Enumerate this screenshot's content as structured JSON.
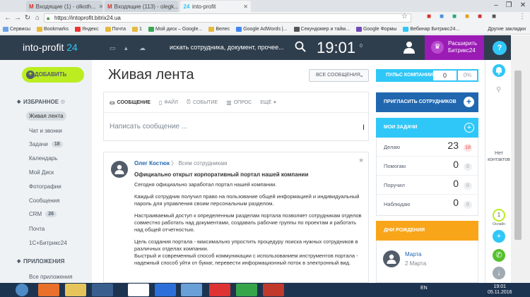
{
  "browser": {
    "tabs": [
      {
        "label": "Входящие (1) - olkoth..."
      },
      {
        "label": "Входящие (113) - olegk..."
      },
      {
        "label": "into-profit"
      }
    ],
    "url": "https://intoprofit.bitrix24.ua",
    "bookmarks": [
      "Сервисы",
      "Bookmarks",
      "Яндекс",
      "Почта",
      "1",
      "Мой диск – Google...",
      "Велес",
      "Google AdWords |...",
      "Секундомер и тайм...",
      "Google Формы",
      "Вебинар Битрикс24..."
    ],
    "other_bookmarks": "Другие закладки"
  },
  "header": {
    "logo_text": "into-profit",
    "logo_num": "24",
    "search_placeholder": "искать сотрудника, документ, прочее...",
    "clock": "19:01",
    "clock_sub": "0",
    "extend_label": "Расширить Битрикс24"
  },
  "leftmenu": {
    "add_button": "ДОБАВИТЬ",
    "favorites_title": "ИЗБРАННОЕ",
    "items": [
      {
        "label": "Живая лента"
      },
      {
        "label": "Чат и звонки"
      },
      {
        "label": "Задачи",
        "count": "18"
      },
      {
        "label": "Календарь"
      },
      {
        "label": "Мой Диск"
      },
      {
        "label": "Фотографии"
      },
      {
        "label": "Сообщения"
      },
      {
        "label": "CRM",
        "count": "26"
      },
      {
        "label": "Почта"
      },
      {
        "label": "1С+Битрикс24"
      }
    ],
    "apps_title": "ПРИЛОЖЕНИЯ",
    "apps_items": [
      {
        "label": "Все приложения"
      }
    ]
  },
  "main": {
    "title": "Живая лента",
    "filter_label": "ВСЕ СООБЩЕНИЯ",
    "composer_tabs": [
      "СООБЩЕНИЕ",
      "ФАЙЛ",
      "СОБЫТИЕ",
      "ОПРОС",
      "ЕЩЁ"
    ],
    "composer_placeholder": "Написать сообщение ...",
    "post": {
      "author": "Олег Костюк",
      "to": "Всем сотрудникам",
      "title": "Официально открыт корпоративный портал нашей компании",
      "paragraphs": [
        "Сегодня официально заработал портал нашей компании.",
        "Каждый сотрудник получил право на пользование общей информацией и индивидуальный пароль для управления своим персональным разделом.",
        "Настраиваемый доступ к определенным разделам портала позволяет сотрудникам отделов совместно работать над документами, создавать рабочие группы по проектам и работать над общей отчетностью.",
        "Цель создания портала - максимально упростить процедуру поиска нужных сотрудников в различных отделах компании.",
        "Быстрый и современный способ коммуникации с использованием инструментов портала - надежный способ уйти от бумаг, перевести информационный поток в электронный вид."
      ]
    }
  },
  "right": {
    "pulse_label": "ПУЛЬС КОМПАНИИ",
    "pulse_value": "0",
    "pulse_percent": "0%",
    "invite_label": "ПРИГЛАСИТЬ СОТРУДНИКОВ",
    "tasks_label": "МОИ ЗАДАЧИ",
    "tasks": [
      {
        "label": "Делаю",
        "value": "23",
        "badge": "18"
      },
      {
        "label": "Помогаю",
        "value": "0",
        "badge": "0"
      },
      {
        "label": "Поручил",
        "value": "0",
        "badge": "0"
      },
      {
        "label": "Наблюдаю",
        "value": "0",
        "badge": "0"
      }
    ],
    "birthdays_label": "ДНИ РОЖДЕНИЯ",
    "birthday_name": "Марта",
    "birthday_date": "2 Марта"
  },
  "rail": {
    "no_contacts": "Нет контактов",
    "online_count": "1",
    "online_label": "Онлайн"
  },
  "taskbar": {
    "lang": "EN",
    "time": "19:01",
    "date": "05.11.2016"
  }
}
